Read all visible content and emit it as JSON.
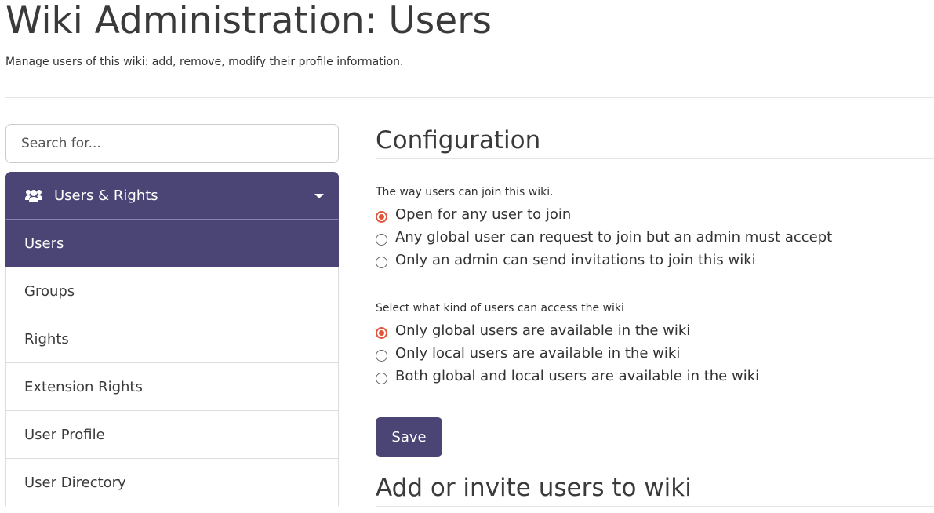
{
  "header": {
    "title": "Wiki Administration: Users",
    "hint": "Manage users of this wiki: add, remove, modify their profile information."
  },
  "sidebar": {
    "search": {
      "placeholder": "Search for...",
      "value": ""
    },
    "category": {
      "label": "Users & Rights",
      "icon": "users-icon"
    },
    "items": [
      {
        "label": "Users",
        "active": true
      },
      {
        "label": "Groups",
        "active": false
      },
      {
        "label": "Rights",
        "active": false
      },
      {
        "label": "Extension Rights",
        "active": false
      },
      {
        "label": "User Profile",
        "active": false
      },
      {
        "label": "User Directory",
        "active": false
      }
    ]
  },
  "main": {
    "configuration": {
      "title": "Configuration",
      "membership": {
        "legend": "The way users can join this wiki.",
        "options": [
          {
            "label": "Open for any user to join",
            "checked": true
          },
          {
            "label": "Any global user can request to join but an admin must accept",
            "checked": false
          },
          {
            "label": "Only an admin can send invitations to join this wiki",
            "checked": false
          }
        ]
      },
      "user_scope": {
        "legend": "Select what kind of users can access the wiki",
        "options": [
          {
            "label": "Only global users are available in the wiki",
            "checked": true
          },
          {
            "label": "Only local users are available in the wiki",
            "checked": false
          },
          {
            "label": "Both global and local users are available in the wiki",
            "checked": false
          }
        ]
      },
      "save_label": "Save"
    },
    "invite": {
      "title": "Add or invite users to wiki"
    }
  },
  "colors": {
    "accent": "#4a4575",
    "radio_checked": "#e2553b"
  }
}
